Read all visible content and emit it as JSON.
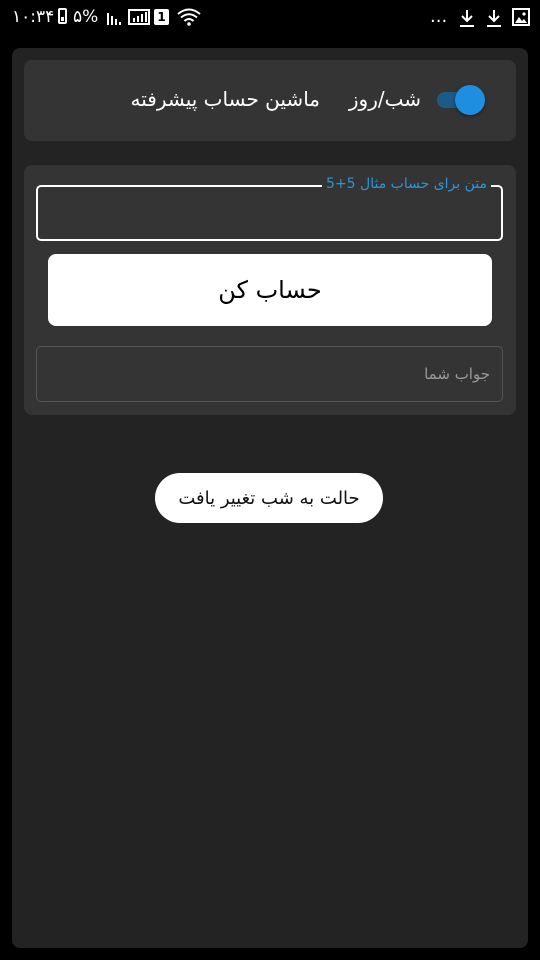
{
  "status_bar": {
    "time": "۱۰:۳۴",
    "battery_percent": "۵%",
    "sim_slot": "1",
    "overflow": "..."
  },
  "header_card": {
    "title": "ماشین حساب پیشرفته",
    "mode_label": "شب/روز",
    "dark_mode_enabled": true
  },
  "calculator": {
    "expression_label": "متن برای حساب مثال 5+5",
    "expression_value": "",
    "calculate_button": "حساب کن",
    "answer_placeholder": "جواب شما",
    "answer_value": ""
  },
  "toast": {
    "message": "حالت به شب تغییر یافت"
  },
  "colors": {
    "accent": "#1e8fe0",
    "card_background": "#343434",
    "app_background": "#232323"
  }
}
